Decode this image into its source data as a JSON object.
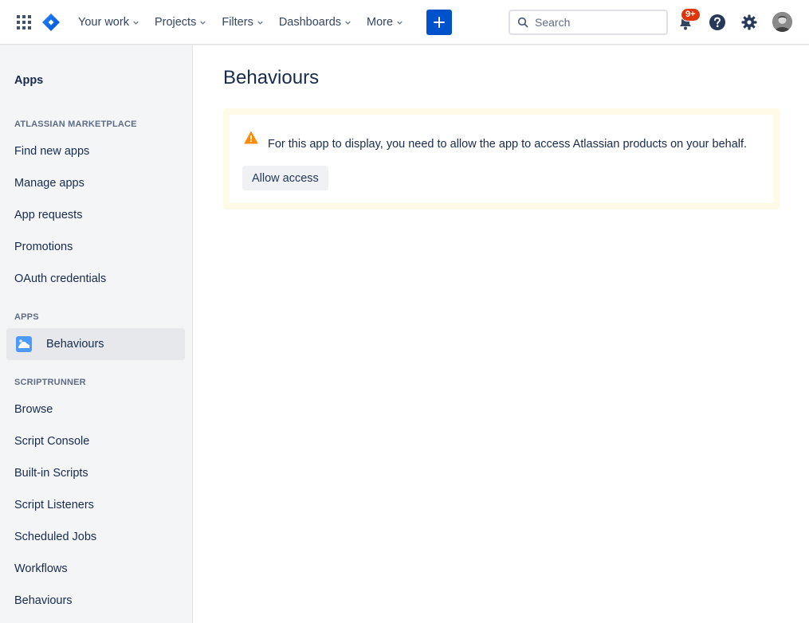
{
  "topnav": {
    "items": [
      {
        "label": "Your work"
      },
      {
        "label": "Projects"
      },
      {
        "label": "Filters"
      },
      {
        "label": "Dashboards"
      },
      {
        "label": "More"
      }
    ],
    "search": {
      "placeholder": "Search"
    },
    "notification_badge": "9+",
    "brand_color": "#0052cc"
  },
  "sidebar": {
    "title": "Apps",
    "sections": [
      {
        "header": "ATLASSIAN MARKETPLACE",
        "items": [
          "Find new apps",
          "Manage apps",
          "App requests",
          "Promotions",
          "OAuth credentials"
        ]
      },
      {
        "header": "APPS",
        "items": [
          "Behaviours"
        ]
      },
      {
        "header": "SCRIPTRUNNER",
        "items": [
          "Browse",
          "Script Console",
          "Built-in Scripts",
          "Script Listeners",
          "Scheduled Jobs",
          "Workflows",
          "Behaviours"
        ]
      }
    ]
  },
  "main": {
    "title": "Behaviours",
    "notice": {
      "text": "For this app to display, you need to allow the app to access Atlassian products on your behalf.",
      "button_label": "Allow access",
      "warning_color": "#ff8b00",
      "background_color": "#fffae6"
    }
  }
}
